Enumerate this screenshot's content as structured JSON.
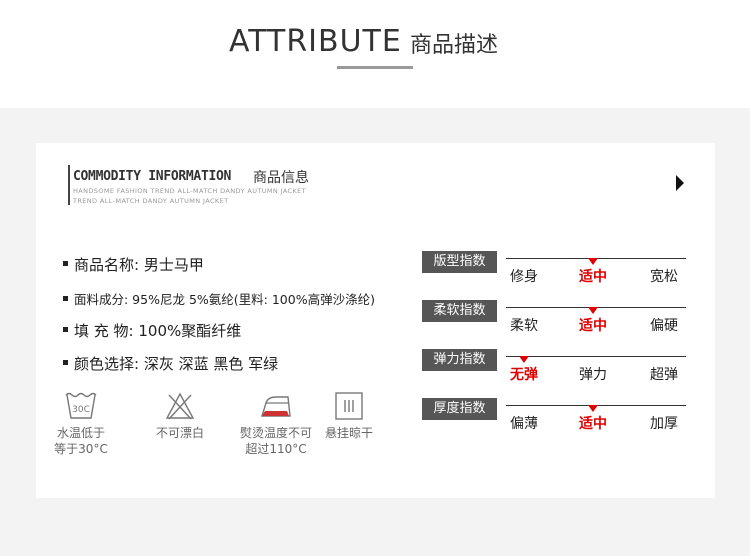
{
  "header": {
    "title_en": "ATTRIBUTE",
    "title_cn": "商品描述"
  },
  "info": {
    "title_en": "COMMODITY INFORMATION",
    "title_cn": "商品信息",
    "sub1": "HANDSOME FASHION TREND ALL-MATCH DANDY AUTUMN JACKET",
    "sub2": "TREND ALL-MATCH DANDY AUTUMN JACKET"
  },
  "specs": [
    {
      "text": "商品名称: 男士马甲"
    },
    {
      "text": "面料成分: 95%尼龙 5%氨纶(里料: 100%高弹沙涤纶)"
    },
    {
      "text": "填 充 物: 100%聚酯纤维"
    },
    {
      "text": "颜色选择: 深灰 深蓝 黑色 军绿"
    }
  ],
  "care": [
    {
      "icon": "wash-30c-icon",
      "badge": "30C",
      "line1": "水温低于",
      "line2": "等于30°C"
    },
    {
      "icon": "no-bleach-icon",
      "line1": "不可漂白",
      "line2": ""
    },
    {
      "icon": "iron-temp-icon",
      "line1": "熨烫温度不可",
      "line2": "超过110°C"
    },
    {
      "icon": "hang-dry-icon",
      "line1": "悬挂晾干",
      "line2": ""
    }
  ],
  "scales": [
    {
      "label": "版型指数",
      "options": [
        "修身",
        "适中",
        "宽松"
      ],
      "active": 1
    },
    {
      "label": "柔软指数",
      "options": [
        "柔软",
        "适中",
        "偏硬"
      ],
      "active": 1
    },
    {
      "label": "弹力指数",
      "options": [
        "无弹",
        "弹力",
        "超弹"
      ],
      "active": 0
    },
    {
      "label": "厚度指数",
      "options": [
        "偏薄",
        "适中",
        "加厚"
      ],
      "active": 1
    }
  ],
  "colors": {
    "accent": "#e00000",
    "label_bg": "#565656"
  }
}
